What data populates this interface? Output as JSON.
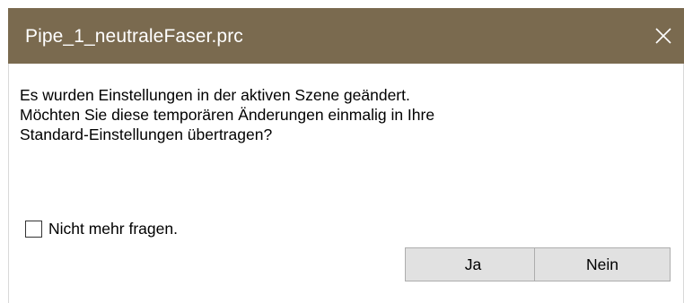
{
  "window": {
    "title": "Pipe_1_neutraleFaser.prc",
    "close_icon": "close-icon",
    "titlebar_color": "#7a6a4f"
  },
  "message": {
    "lines": [
      "Es wurden Einstellungen in der aktiven Szene geändert.",
      "Möchten Sie diese temporären Änderungen einmalig in Ihre",
      "Standard-Einstellungen übertragen?"
    ]
  },
  "checkbox": {
    "label": "Nicht mehr fragen.",
    "checked": false
  },
  "buttons": {
    "yes_label": "Ja",
    "no_label": "Nein"
  }
}
